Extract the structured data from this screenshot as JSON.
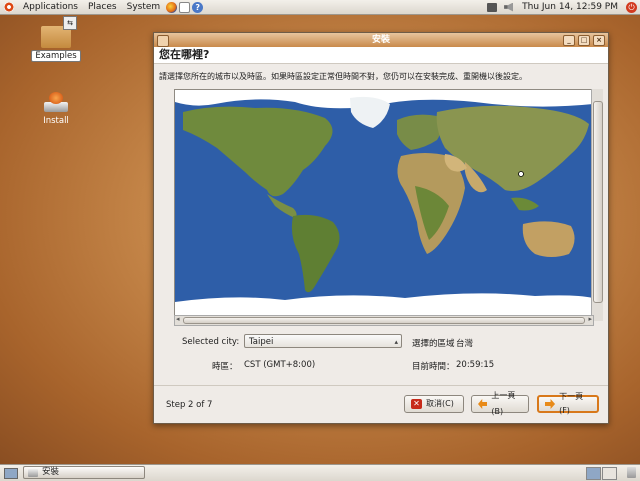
{
  "top_panel": {
    "menus": [
      "Applications",
      "Places",
      "System"
    ],
    "clock": "Thu Jun 14, 12:59 PM"
  },
  "desktop": {
    "icons": [
      {
        "label": "Examples"
      },
      {
        "label": "Install"
      }
    ]
  },
  "window": {
    "title": "安裝",
    "page_title": "您在哪裡?",
    "instruction": "請選擇您所在的城市以及時區。如果時區設定正常但時間不對，您仍可以在安裝完成、重開機以後設定。",
    "city_label": "Selected city:",
    "city_value": "Taipei",
    "region_label": "選擇的區域",
    "region_value": "台灣",
    "timezone_label": "時區：",
    "timezone_value": "CST (GMT+8:00)",
    "current_time_label": "目前時間：",
    "current_time_value": "20:59:15",
    "step": "Step 2 of 7",
    "buttons": {
      "cancel": "取消(C)",
      "back": "上一頁(B)",
      "forward": "下一頁(F)"
    }
  },
  "taskbar": {
    "task_label": "安裝"
  },
  "colors": {
    "ocean": "#2e5ea8",
    "land": "#6f8a3d",
    "ice": "#ffffff",
    "accent": "#d8781a"
  }
}
